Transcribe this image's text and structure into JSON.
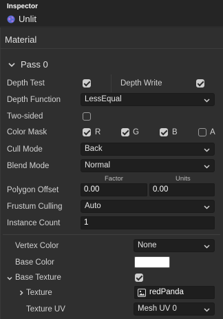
{
  "header": {
    "title": "Inspector",
    "object_name": "Unlit",
    "object_icon": "globe-icon"
  },
  "material": {
    "section_title": "Material",
    "pass": {
      "label": "Pass 0",
      "expanded": true
    },
    "depth_test": {
      "label": "Depth Test",
      "checked": true
    },
    "depth_write": {
      "label": "Depth Write",
      "checked": true
    },
    "depth_function": {
      "label": "Depth Function",
      "value": "LessEqual"
    },
    "two_sided": {
      "label": "Two-sided",
      "checked": false
    },
    "color_mask": {
      "label": "Color Mask",
      "channels": [
        {
          "name": "R",
          "checked": true
        },
        {
          "name": "G",
          "checked": true
        },
        {
          "name": "B",
          "checked": true
        },
        {
          "name": "A",
          "checked": false
        }
      ]
    },
    "cull_mode": {
      "label": "Cull Mode",
      "value": "Back"
    },
    "blend_mode": {
      "label": "Blend Mode",
      "value": "Normal"
    },
    "polygon_offset": {
      "label": "Polygon Offset",
      "factor_label": "Factor",
      "units_label": "Units",
      "factor": "0.00",
      "units": "0.00"
    },
    "frustum_culling": {
      "label": "Frustum Culling",
      "value": "Auto"
    },
    "instance_count": {
      "label": "Instance Count",
      "value": "1"
    },
    "vertex_color": {
      "label": "Vertex Color",
      "value": "None"
    },
    "base_color": {
      "label": "Base Color",
      "color": "#ffffff"
    },
    "base_texture": {
      "label": "Base Texture",
      "checked": true
    },
    "texture": {
      "label": "Texture",
      "value": "redPanda",
      "icon": "image-icon"
    },
    "texture_uv": {
      "label": "Texture UV",
      "value": "Mesh UV 0"
    }
  }
}
